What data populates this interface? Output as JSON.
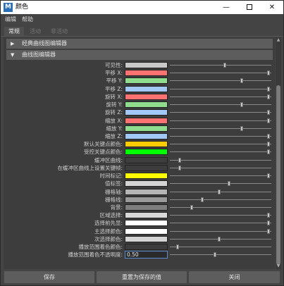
{
  "window": {
    "title": "颜色",
    "app_icon_letter": "M",
    "minimize": "—",
    "close": "✕"
  },
  "menu": [
    "编辑",
    "帮助"
  ],
  "tabs": [
    {
      "label": "常规",
      "active": true
    },
    {
      "label": "活动",
      "active": false
    },
    {
      "label": "非活动",
      "active": false
    }
  ],
  "sections": [
    {
      "label": "经典曲线图编辑器",
      "expanded": false
    },
    {
      "label": "曲线图编辑器",
      "expanded": true
    }
  ],
  "rows": [
    {
      "label": "可见性:",
      "color": "#c8c8c8",
      "slider": 0.56
    },
    {
      "label": "平移 X:",
      "color": "#ff7272",
      "slider": 1.0
    },
    {
      "label": "平移 Y:",
      "color": "#8fdc8f",
      "slider": 0.73
    },
    {
      "label": "平移 Z:",
      "color": "#a2c8f8",
      "slider": 1.0
    },
    {
      "label": "旋转 X:",
      "color": "#ff7272",
      "slider": 1.0
    },
    {
      "label": "旋转 Y:",
      "color": "#8fdc8f",
      "slider": 0.73
    },
    {
      "label": "旋转 Z:",
      "color": "#a2c8f8",
      "slider": 1.0
    },
    {
      "label": "缩放 X:",
      "color": "#ff7272",
      "slider": 1.0
    },
    {
      "label": "缩放 Y:",
      "color": "#8fdc8f",
      "slider": 0.73
    },
    {
      "label": "缩放 Z:",
      "color": "#a2c8f8",
      "slider": 1.0
    },
    {
      "label": "默认关键点颜色:",
      "color": "#ffcc00",
      "slider": 1.0
    },
    {
      "label": "受控关键点颜色:",
      "color": "#00ff00",
      "slider": 1.0
    },
    {
      "label": "缓冲区曲线:",
      "color": "#3d3d3d",
      "slider": 0.1
    },
    {
      "label": "在缓冲区曲线上设置关键帧:",
      "color": "#3d3d3d",
      "slider": 0.1
    },
    {
      "label": "时间标记:",
      "color": "#ffff00",
      "slider": 1.0
    },
    {
      "label": "值标签:",
      "color": "#d4d4d4",
      "slider": 0.6
    },
    {
      "label": "栅格轴:",
      "color": "#b5b5b5",
      "slider": 0.5
    },
    {
      "label": "栅格线:",
      "color": "#9a9a9a",
      "slider": 0.33
    },
    {
      "label": "背景:",
      "color": "#7e7e7e",
      "slider": 0.22
    },
    {
      "label": "区域选择:",
      "color": "#d9d9d9",
      "slider": 1.0
    },
    {
      "label": "选择前先显:",
      "color": "#ffffff",
      "slider": 1.0
    },
    {
      "label": "主选择颜色:",
      "color": "#ffffff",
      "slider": 1.0
    },
    {
      "label": "次选择颜色:",
      "color": "#d4d4d4",
      "slider": 0.5
    },
    {
      "label": "播放范围着色颜色:",
      "color": "#3d3d3d",
      "slider": 0.08
    },
    {
      "label": "播放范围着色不透明度:",
      "input": "0.50",
      "slider": 0.46
    }
  ],
  "buttons": {
    "save": "保存",
    "reset": "重置为保存的值",
    "close": "关闭"
  }
}
